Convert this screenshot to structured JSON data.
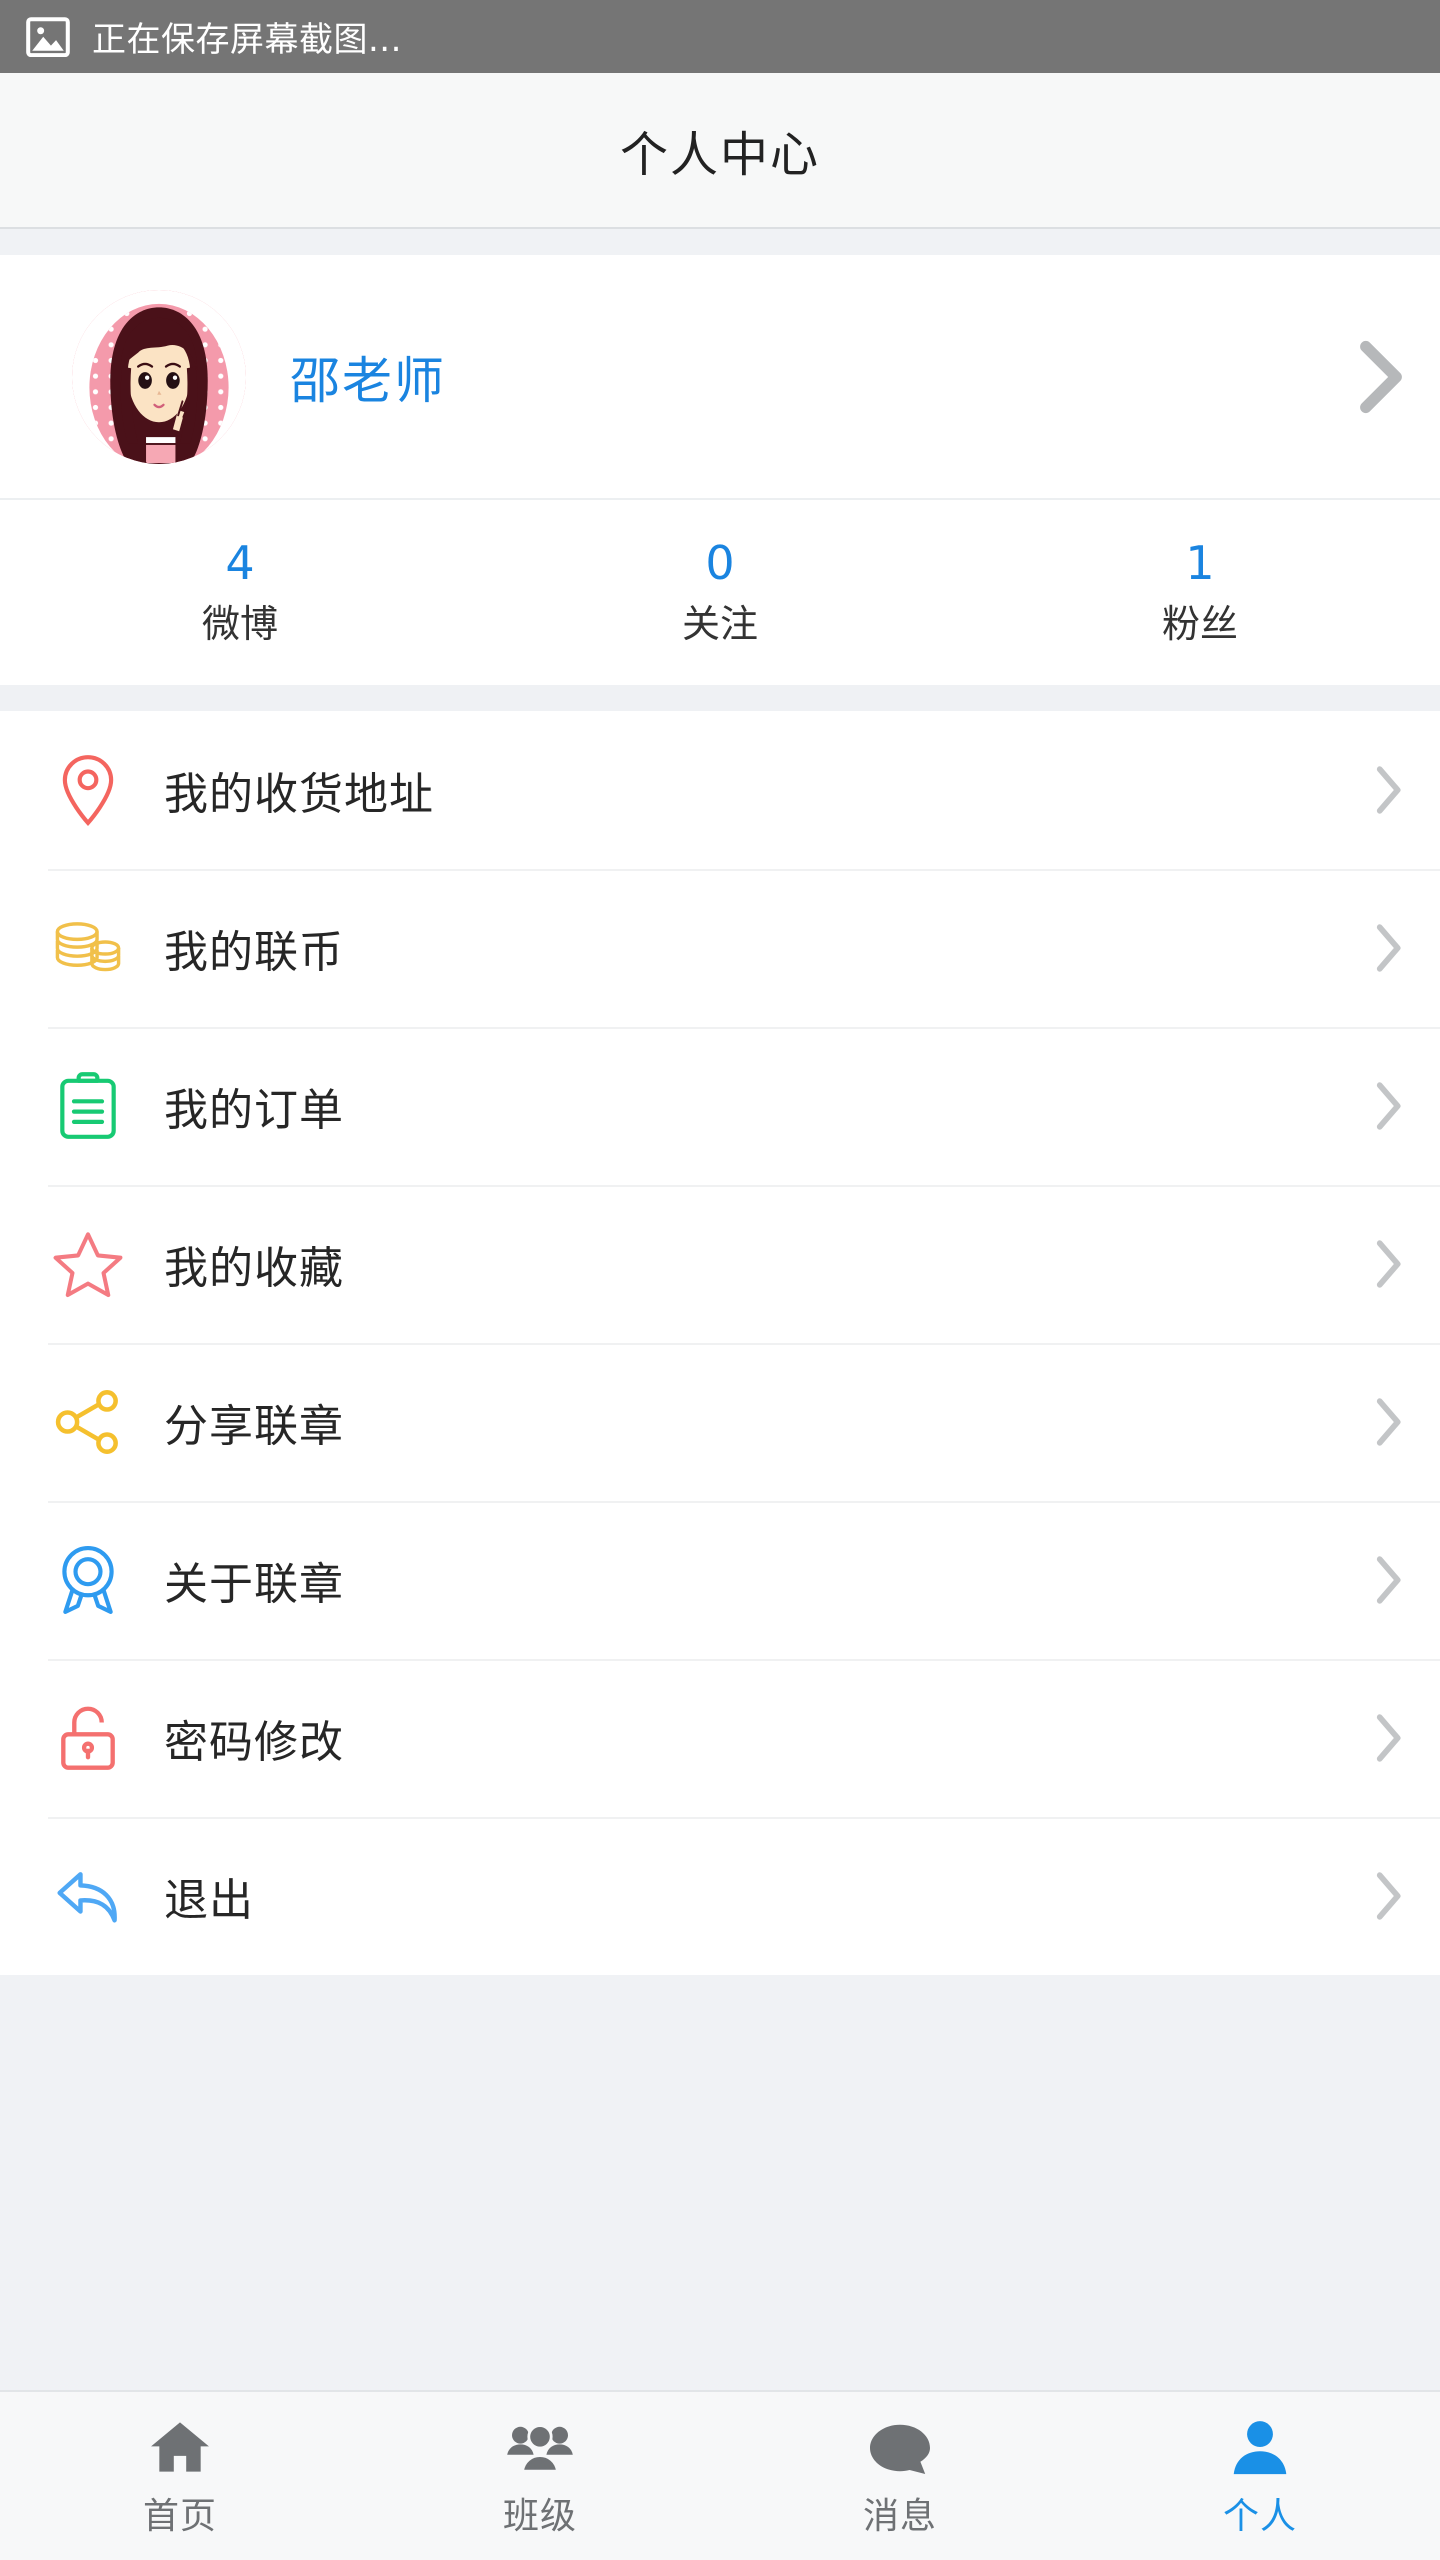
{
  "statusbar": {
    "icon": "image-icon",
    "text": "正在保存屏幕截图..."
  },
  "header": {
    "title": "个人中心"
  },
  "profile": {
    "avatar_name": "user-avatar",
    "username": "邵老师",
    "chevron": "chevron-right-icon"
  },
  "stats": [
    {
      "value": "4",
      "label": "微博"
    },
    {
      "value": "0",
      "label": "关注"
    },
    {
      "value": "1",
      "label": "粉丝"
    }
  ],
  "menu": [
    {
      "label": "我的收货地址",
      "icon": "location-pin-icon",
      "color": "#f4655f"
    },
    {
      "label": "我的联币",
      "icon": "coins-icon",
      "color": "#f1c04a"
    },
    {
      "label": "我的订单",
      "icon": "clipboard-icon",
      "color": "#17ca73"
    },
    {
      "label": "我的收藏",
      "icon": "star-icon",
      "color": "#f47b82"
    },
    {
      "label": "分享联章",
      "icon": "share-icon",
      "color": "#f5c02e"
    },
    {
      "label": "关于联章",
      "icon": "medal-icon",
      "color": "#2e9bf0"
    },
    {
      "label": "密码修改",
      "icon": "unlock-icon",
      "color": "#f4706f"
    },
    {
      "label": "退出",
      "icon": "reply-arrow-icon",
      "color": "#4fa8f5"
    }
  ],
  "tabbar": {
    "active_color": "#1a90e6",
    "inactive_color": "#6e7174",
    "items": [
      {
        "label": "首页",
        "icon": "home-icon",
        "active": false
      },
      {
        "label": "班级",
        "icon": "people-icon",
        "active": false
      },
      {
        "label": "消息",
        "icon": "chat-icon",
        "active": false
      },
      {
        "label": "个人",
        "icon": "person-icon",
        "active": true
      }
    ]
  }
}
